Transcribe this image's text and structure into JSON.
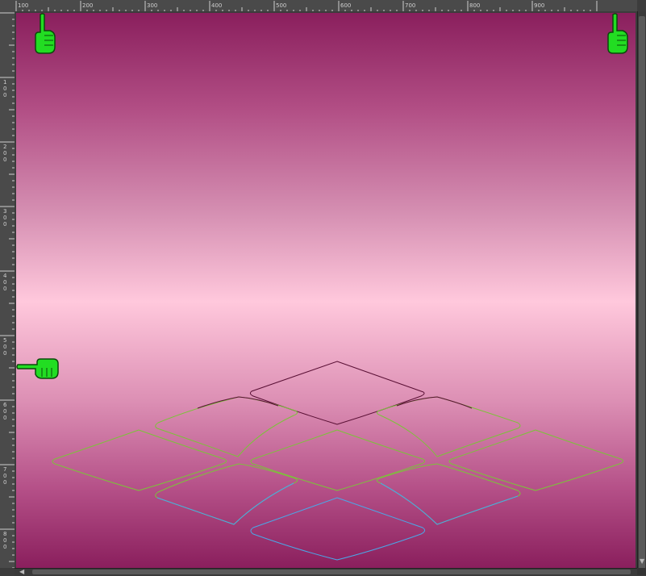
{
  "rulers": {
    "horizontal_labels": [
      "100",
      "200",
      "300",
      "400",
      "500",
      "600",
      "700",
      "800",
      "900"
    ],
    "vertical_labels": [
      "100",
      "200",
      "300",
      "400",
      "500",
      "600",
      "700",
      "800"
    ]
  },
  "canvas": {
    "gradient_colors": [
      "#8a1f5d",
      "#ffc8dc"
    ],
    "grid_colors": {
      "far_edge": "#5a1035",
      "middle_edge": "#7cc23a",
      "near_edge": "#4aa8e8"
    }
  },
  "guides": [
    {
      "name": "vertical-guide-left",
      "icon": "pointing-hand-up-icon"
    },
    {
      "name": "vertical-guide-right",
      "icon": "pointing-hand-up-icon"
    },
    {
      "name": "horizontal-guide",
      "icon": "pointing-hand-left-icon"
    }
  ]
}
